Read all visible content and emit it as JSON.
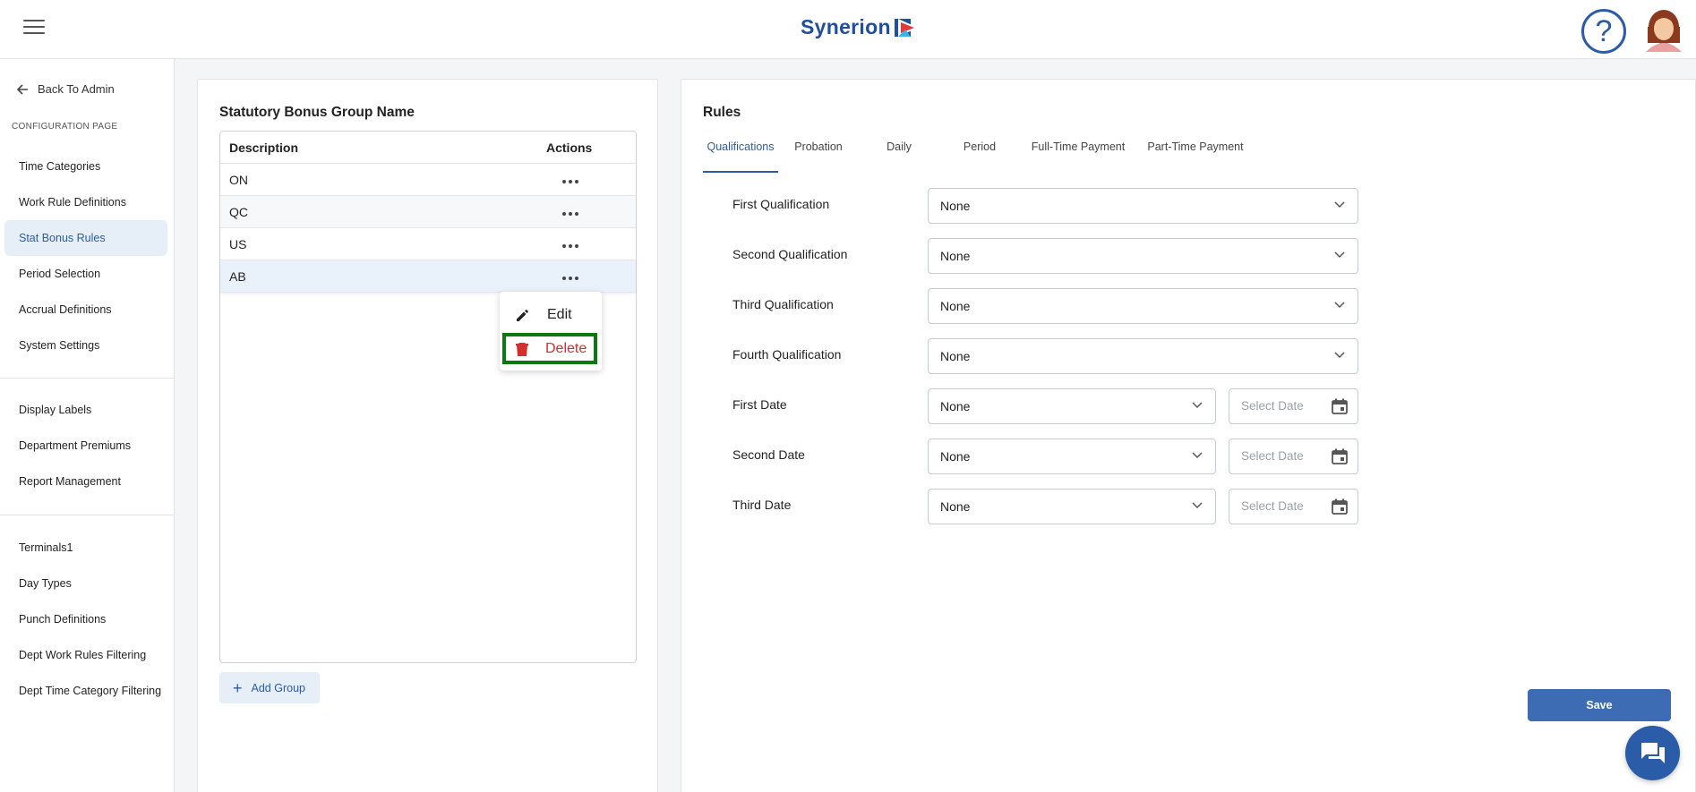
{
  "app": {
    "logo_text": "Synerion",
    "help_glyph": "?"
  },
  "sidebar": {
    "back_label": "Back To Admin",
    "section_title": "CONFIGURATION PAGE",
    "group1": [
      {
        "label": "Time Categories"
      },
      {
        "label": "Work Rule Definitions"
      },
      {
        "label": "Stat Bonus Rules",
        "active": true
      },
      {
        "label": "Period Selection"
      },
      {
        "label": "Accrual Definitions"
      },
      {
        "label": "System Settings"
      }
    ],
    "group2": [
      {
        "label": "Display Labels"
      },
      {
        "label": "Department Premiums"
      },
      {
        "label": "Report Management"
      }
    ],
    "group3": [
      {
        "label": "Terminals1"
      },
      {
        "label": "Day Types"
      },
      {
        "label": "Punch Definitions"
      },
      {
        "label": "Dept Work Rules Filtering"
      },
      {
        "label": "Dept Time Category Filtering"
      }
    ]
  },
  "groups_panel": {
    "title": "Statutory Bonus Group Name",
    "columns": [
      "Description",
      "Actions"
    ],
    "rows": [
      {
        "description": "ON"
      },
      {
        "description": "QC"
      },
      {
        "description": "US"
      },
      {
        "description": "AB",
        "selected": true
      }
    ],
    "context_menu": {
      "edit_label": "Edit",
      "delete_label": "Delete"
    },
    "add_group_label": "Add Group"
  },
  "rules_panel": {
    "title": "Rules",
    "tabs": [
      {
        "label": "Qualifications",
        "active": true
      },
      {
        "label": "Probation"
      },
      {
        "label": "Daily"
      },
      {
        "label": "Period"
      },
      {
        "label": "Full-Time Payment"
      },
      {
        "label": "Part-Time Payment"
      }
    ],
    "fields": {
      "first_qualification": {
        "label": "First Qualification",
        "value": "None"
      },
      "second_qualification": {
        "label": "Second Qualification",
        "value": "None"
      },
      "third_qualification": {
        "label": "Third Qualification",
        "value": "None"
      },
      "fourth_qualification": {
        "label": "Fourth Qualification",
        "value": "None"
      },
      "first_date": {
        "label": "First Date",
        "value": "None",
        "date_placeholder": "Select Date"
      },
      "second_date": {
        "label": "Second Date",
        "value": "None",
        "date_placeholder": "Select Date"
      },
      "third_date": {
        "label": "Third Date",
        "value": "None",
        "date_placeholder": "Select Date"
      }
    },
    "save_label": "Save"
  },
  "colors": {
    "brand_blue": "#2b5ca8",
    "delete_red": "#d32f2f",
    "highlight_green": "#0a7a10",
    "active_nav_bg": "#e6eef8"
  },
  "icons": [
    "menu-icon",
    "help-icon",
    "avatar",
    "arrow-left-icon",
    "more-horizontal-icon",
    "pencil-icon",
    "trash-icon",
    "plus-icon",
    "chevron-down-icon",
    "calendar-icon",
    "chat-icon"
  ]
}
